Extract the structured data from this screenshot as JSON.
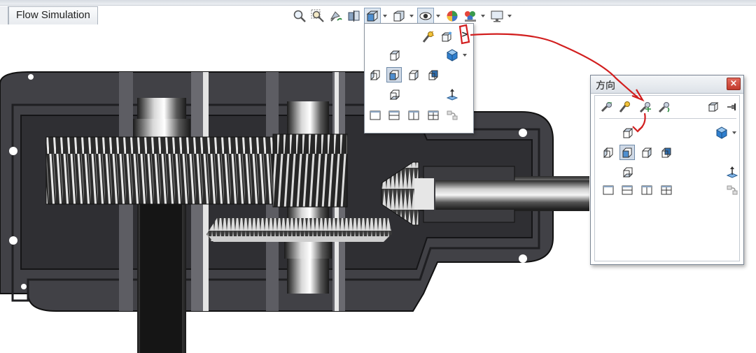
{
  "tabs": [
    {
      "label": "Flow Simulation"
    }
  ],
  "toolbar": {
    "icons": [
      "zoom-to-fit-icon",
      "zoom-to-area-icon",
      "previous-view-icon",
      "section-view-icon",
      "view-orientation-icon",
      "display-style-icon",
      "hide-show-items-icon",
      "edit-appearance-icon",
      "apply-scene-icon",
      "view-settings-icon"
    ]
  },
  "orientation_dialog": {
    "title": "方向",
    "close_label": "×"
  },
  "popup": {
    "more_label": ">"
  },
  "colors": {
    "annotation_red": "#d21f1f",
    "housing_dark": "#3a3a3e",
    "selection_blue": "#cfd9e6"
  }
}
